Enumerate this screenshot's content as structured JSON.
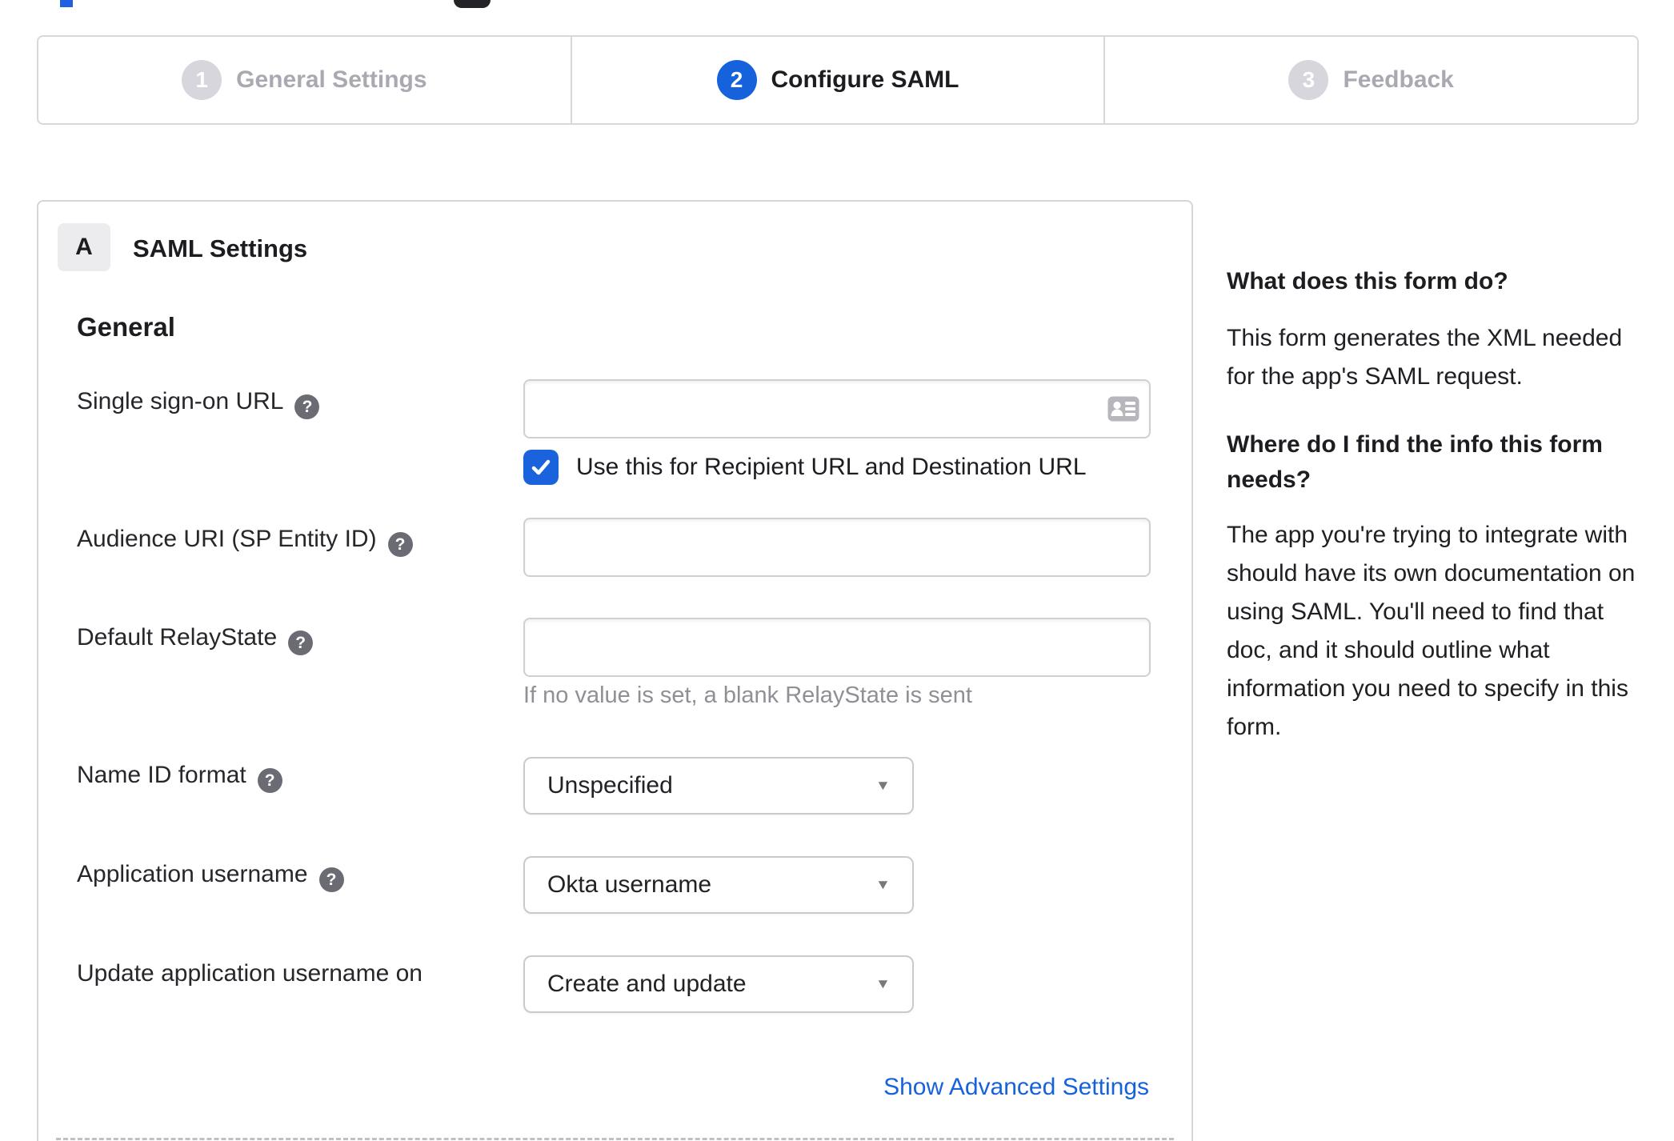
{
  "stepper": {
    "steps": [
      {
        "number": "1",
        "label": "General Settings",
        "state": "inactive"
      },
      {
        "number": "2",
        "label": "Configure SAML",
        "state": "active"
      },
      {
        "number": "3",
        "label": "Feedback",
        "state": "inactive"
      }
    ]
  },
  "panel": {
    "badge": "A",
    "title": "SAML Settings",
    "section": "General",
    "fields": {
      "sso_url": {
        "label": "Single sign-on URL",
        "value": ""
      },
      "use_for_recipient": {
        "label": "Use this for Recipient URL and Destination URL",
        "checked": true
      },
      "audience_uri": {
        "label": "Audience URI (SP Entity ID)",
        "value": ""
      },
      "default_relay_state": {
        "label": "Default RelayState",
        "value": "",
        "hint": "If no value is set, a blank RelayState is sent"
      },
      "name_id_format": {
        "label": "Name ID format",
        "value": "Unspecified"
      },
      "application_username": {
        "label": "Application username",
        "value": "Okta username"
      },
      "update_application_username_on": {
        "label": "Update application username on",
        "value": "Create and update"
      }
    },
    "advanced_link": "Show Advanced Settings"
  },
  "sidebar": {
    "what": {
      "heading": "What does this form do?",
      "body": "This form generates the XML needed\nfor the app's SAML request."
    },
    "where": {
      "heading": "Where do I find the info this form\nneeds?",
      "body": "The app you're trying to integrate with\nshould have its own documentation on\nusing SAML. You'll need to find that\ndoc, and it should outline what\ninformation you need to specify in this\nform."
    }
  },
  "icons": {
    "help": "?",
    "caret": "▼"
  },
  "colors": {
    "accent_blue": "#1662dd",
    "checkbox_blue": "#1b63dd",
    "inactive_gray": "#a9a9b2",
    "text_dark": "#1d1d21",
    "hint_gray": "#8f8f96",
    "border_gray": "#d6d6da"
  }
}
